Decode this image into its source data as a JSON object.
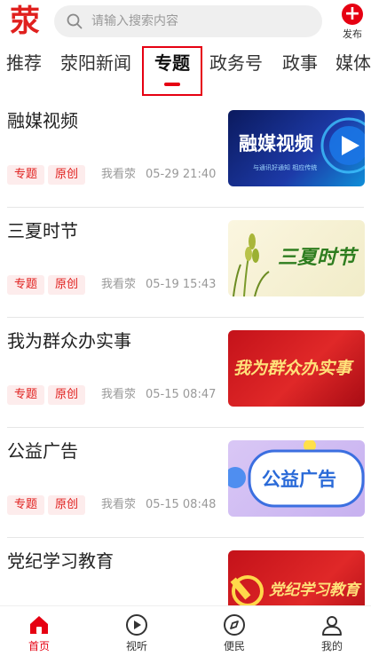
{
  "header": {
    "logo_text": "荥",
    "search_placeholder": "请输入搜索内容",
    "publish_label": "发布"
  },
  "tabs": [
    {
      "label": "推荐"
    },
    {
      "label": "荥阳新闻"
    },
    {
      "label": "专题",
      "active": true
    },
    {
      "label": "政务号"
    },
    {
      "label": "政事"
    },
    {
      "label": "媒体"
    }
  ],
  "articles": [
    {
      "title": "融媒视频",
      "tags": [
        "专题",
        "原创"
      ],
      "source": "我看荥",
      "time": "05-29 21:40",
      "thumb_text": "融媒视频",
      "thumb_subtext": "与通讯好通知 相应传统"
    },
    {
      "title": "三夏时节",
      "tags": [
        "专题",
        "原创"
      ],
      "source": "我看荥",
      "time": "05-19 15:43",
      "thumb_text": "三夏时节"
    },
    {
      "title": "我为群众办实事",
      "tags": [
        "专题",
        "原创"
      ],
      "source": "我看荥",
      "time": "05-15 08:47",
      "thumb_text": "我为群众办实事"
    },
    {
      "title": "公益广告",
      "tags": [
        "专题",
        "原创"
      ],
      "source": "我看荥",
      "time": "05-15 08:48",
      "thumb_text": "公益广告"
    },
    {
      "title": "党纪学习教育",
      "tags": [],
      "source": "",
      "time": "",
      "thumb_text": "党纪学习教育"
    }
  ],
  "bottom_nav": [
    {
      "label": "首页",
      "icon": "home-icon",
      "active": true
    },
    {
      "label": "视听",
      "icon": "play-icon"
    },
    {
      "label": "便民",
      "icon": "compass-icon"
    },
    {
      "label": "我的",
      "icon": "user-icon"
    }
  ],
  "colors": {
    "accent": "#e60012",
    "tag_bg": "#fdecec",
    "tag_text": "#e0201e"
  }
}
